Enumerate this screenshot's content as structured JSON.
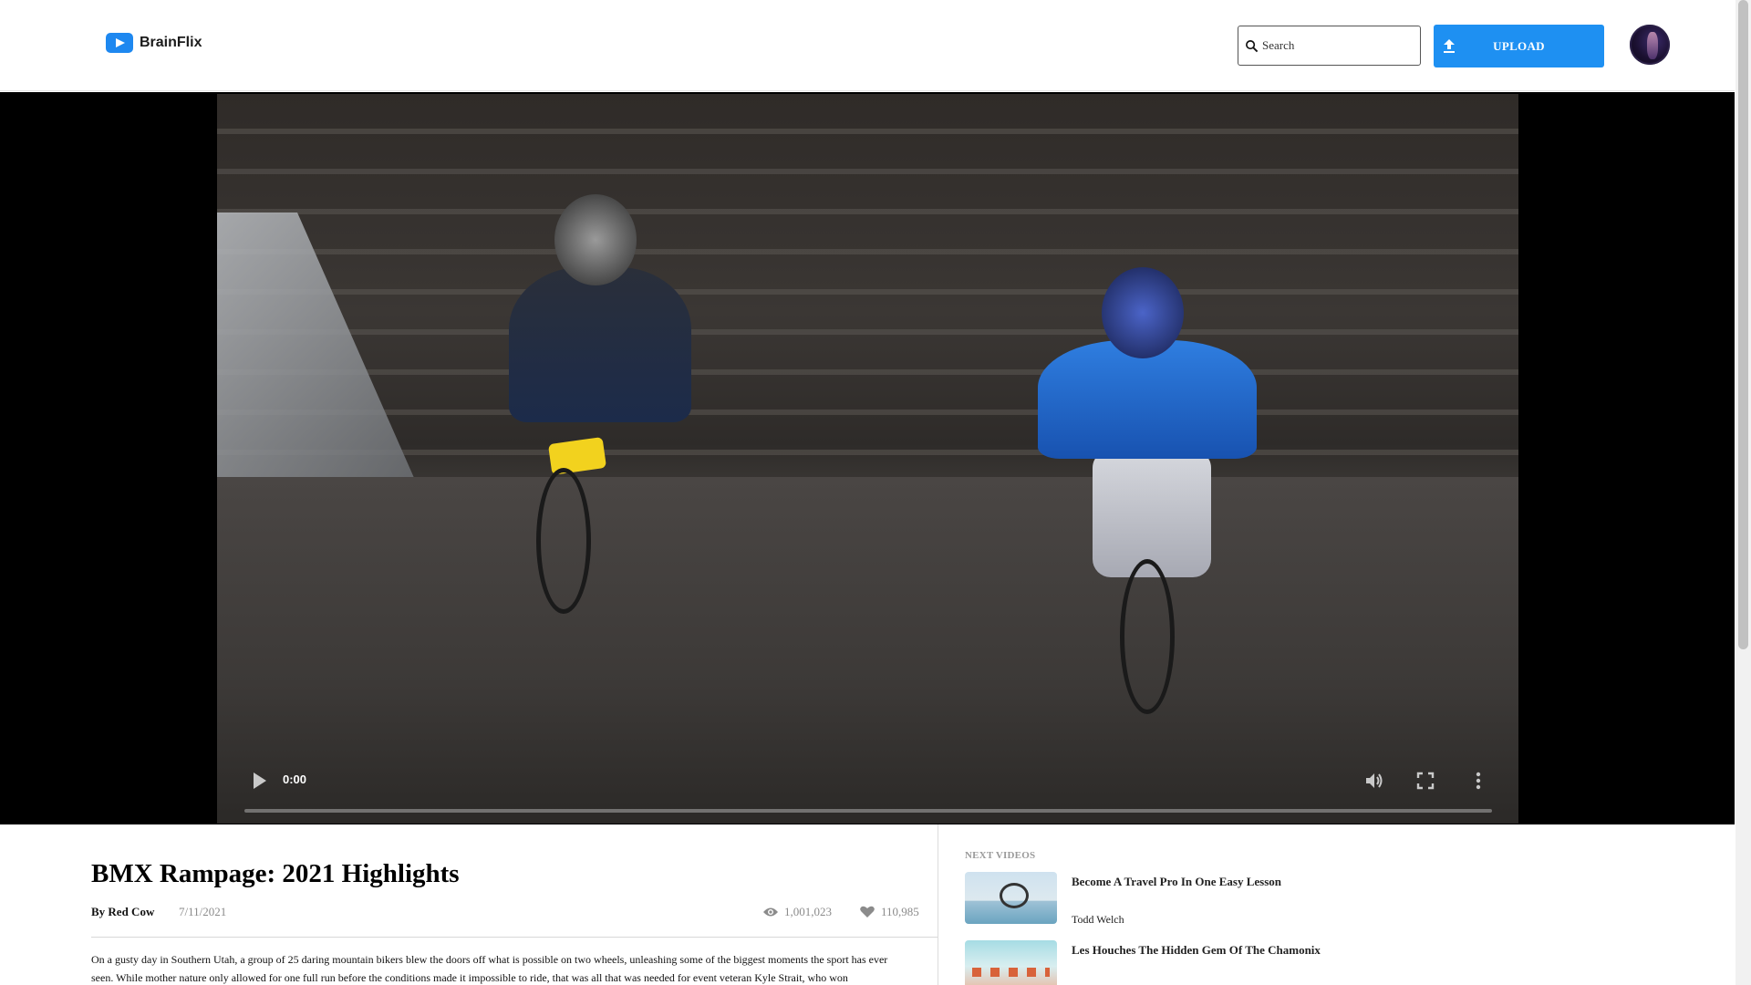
{
  "app": {
    "name": "BrainFlix"
  },
  "header": {
    "search_placeholder": "Search",
    "upload_label": "UPLOAD"
  },
  "player": {
    "current_time": "0:00",
    "progress": 0
  },
  "video": {
    "title": "BMX Rampage: 2021 Highlights",
    "author": "By Red Cow",
    "date": "7/11/2021",
    "views": "1,001,023",
    "likes": "110,985",
    "description": "On a gusty day in Southern Utah, a group of 25 daring mountain bikers blew the doors off what is possible on two wheels, unleashing some of the biggest moments the sport has ever seen. While mother nature only allowed for one full run before the conditions made it impossible to ride, that was all that was needed for event veteran Kyle Strait, who won"
  },
  "next_videos": {
    "heading": "NEXT VIDEOS",
    "items": [
      {
        "title": "Become A Travel Pro In One Easy Lesson",
        "channel": "Todd Welch"
      },
      {
        "title": "Les Houches The Hidden Gem Of The Chamonix",
        "channel": ""
      }
    ]
  },
  "colors": {
    "accent": "#1e90f2",
    "muted": "#8b8b8b"
  },
  "icons": [
    "upload-icon",
    "search-icon",
    "play-icon",
    "volume-icon",
    "fullscreen-icon",
    "more-icon",
    "views-icon",
    "likes-icon"
  ]
}
